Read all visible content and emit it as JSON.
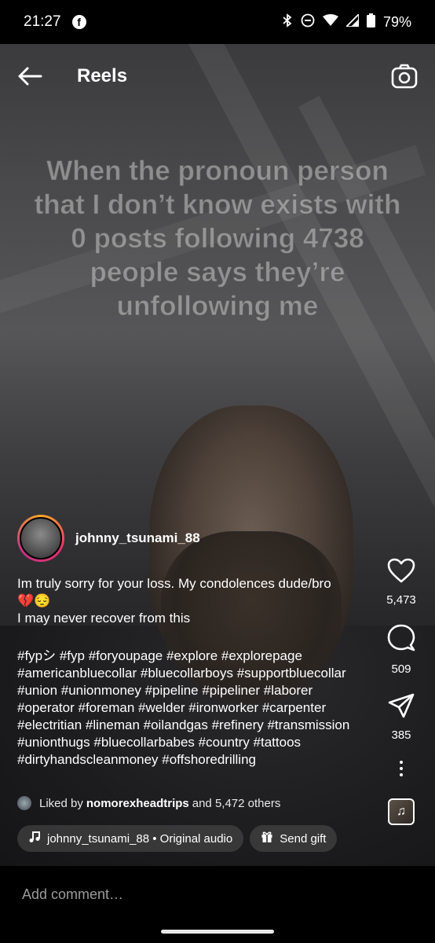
{
  "status_bar": {
    "time": "21:27",
    "battery": "79%"
  },
  "top_bar": {
    "title": "Reels"
  },
  "video": {
    "overlay_text": "When the pronoun person that I don’t know exists with 0 posts following 4738 people says they’re unfollowing me"
  },
  "author": {
    "username": "johnny_tsunami_88"
  },
  "caption": {
    "line1": "Im truly sorry for your loss. My condolences dude/bro",
    "emoji": "💔😔",
    "line2": "I may never recover from this",
    "hashtags": "#fypシ #fyp #foryoupage #explore #explorepage #americanbluecollar #bluecollarboys #supportbluecollar #union #unionmoney #pipeline #pipeliner #laborer #operator #foreman #welder #ironworker #carpenter #electritian #lineman #oilandgas #refinery #transmission #unionthugs #bluecollarbabes #country #tattoos #dirtyhandscleanmoney #offshoredrilling"
  },
  "liked_by": {
    "prefix": "Liked by",
    "user": "nomorexheadtrips",
    "suffix": "and 5,472 others"
  },
  "rail": {
    "likes": "5,473",
    "comments": "509",
    "shares": "385"
  },
  "chips": {
    "audio": "johnny_tsunami_88 • Original audio",
    "gift": "Send gift"
  },
  "comment_bar": {
    "placeholder": "Add comment…"
  },
  "icons": [
    "facebook-icon",
    "bluetooth-icon",
    "dnd-icon",
    "wifi-icon",
    "signal-icon",
    "battery-icon",
    "back-arrow-icon",
    "camera-icon",
    "heart-icon",
    "comment-icon",
    "share-icon",
    "more-icon",
    "music-note-icon",
    "gift-icon"
  ]
}
